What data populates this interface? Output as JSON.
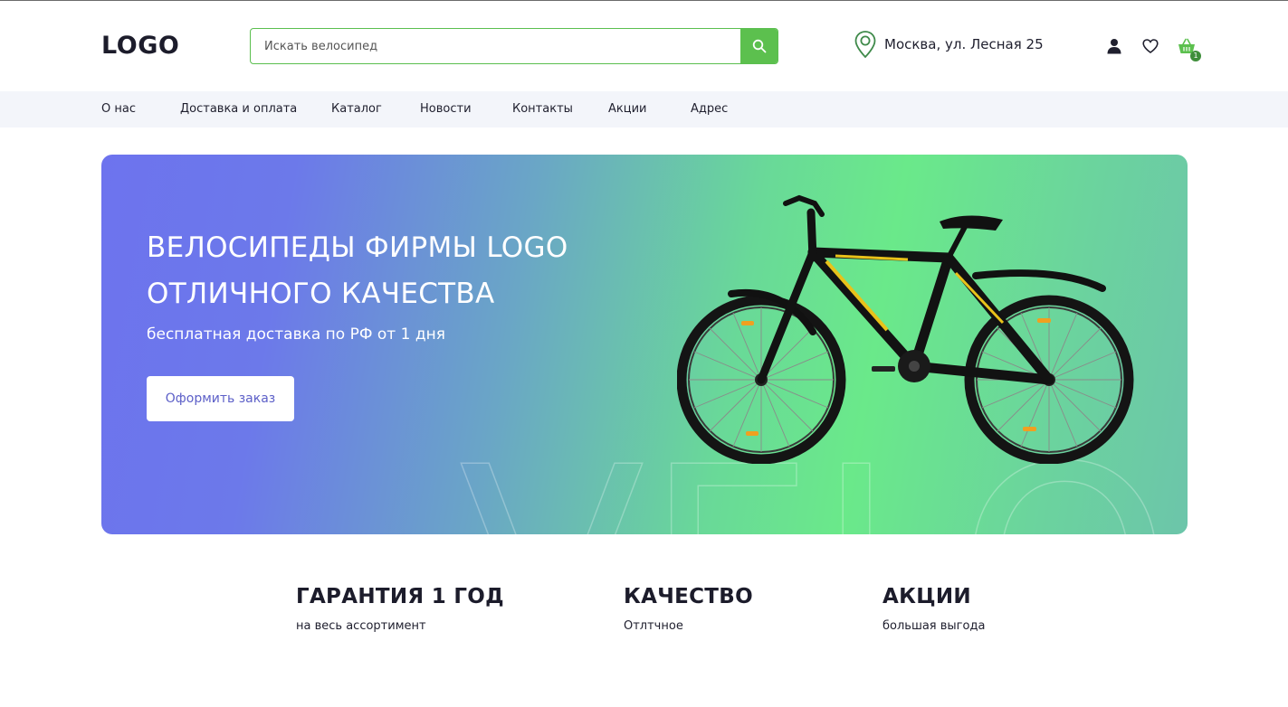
{
  "header": {
    "logo": "LOGO",
    "search": {
      "placeholder": "Искать велосипед",
      "value": ""
    },
    "location": "Москва, ул. Лесная 25",
    "cart_count": "1"
  },
  "nav": {
    "items": [
      "О нас",
      "Доставка и оплата",
      "Каталог",
      "Новости",
      "Контакты",
      "Акции",
      "Адрес"
    ]
  },
  "hero": {
    "title_line1": "ВЕЛОСИПЕДЫ ФИРМЫ LOGO",
    "title_line2": "ОТЛИЧНОГО КАЧЕСТВА",
    "subtitle": "бесплатная доставка по РФ от 1 дня",
    "button": "Оформить заказ",
    "watermark": "VELO"
  },
  "features": [
    {
      "title": "ГАРАНТИЯ 1 ГОД",
      "subtitle": "на весь ассортимент"
    },
    {
      "title": "КАЧЕСТВО",
      "subtitle": "Отлтчное"
    },
    {
      "title": "АКЦИИ",
      "subtitle": "большая выгода"
    }
  ],
  "colors": {
    "accent_green": "#5cc04e",
    "dark_text": "#1c1c2b",
    "nav_bg": "#f3f5fa",
    "hero_start": "#6d73ee",
    "hero_mid": "#6ae98a",
    "button_text": "#5d60c8"
  },
  "icons": {
    "search": "search-icon",
    "location": "map-pin-icon",
    "user": "user-icon",
    "favorites": "heart-icon",
    "cart": "basket-icon"
  }
}
